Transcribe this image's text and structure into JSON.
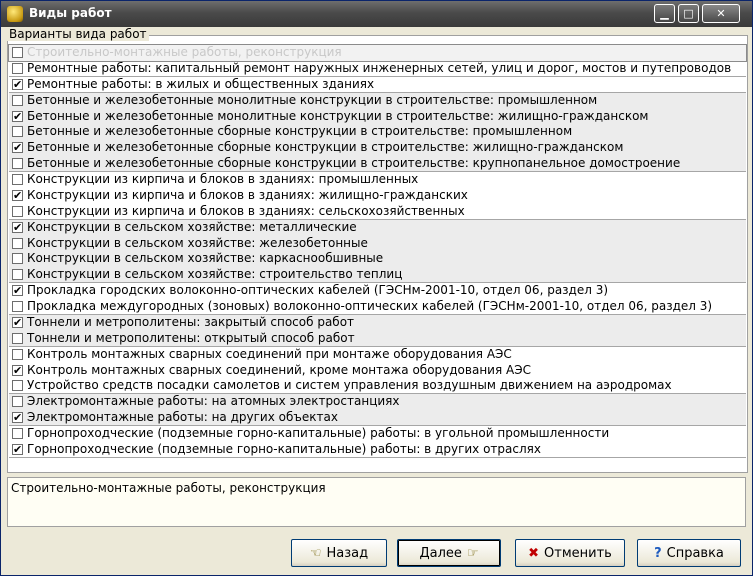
{
  "window": {
    "title": "Виды работ"
  },
  "titlebar": {
    "minimize": "▁",
    "maximize": "□",
    "close": "✕"
  },
  "group": {
    "label": "Варианты вида работ"
  },
  "items": [
    {
      "label": "Строительно-монтажные работы, реконструкция",
      "checked": false,
      "selected": true
    },
    {
      "label": "Ремонтные работы: капитальный ремонт наружных инженерных сетей, улиц и дорог, мостов и путепроводов",
      "checked": false
    },
    {
      "label": "Ремонтные работы: в жилых и общественных зданиях",
      "checked": true
    },
    {
      "label": "Бетонные и железобетонные монолитные конструкции в строительстве: промышленном",
      "checked": false
    },
    {
      "label": "Бетонные и железобетонные монолитные конструкции в строительстве: жилищно-гражданском",
      "checked": true
    },
    {
      "label": "Бетонные и железобетонные сборные конструкции в строительстве: промышленном",
      "checked": false
    },
    {
      "label": "Бетонные и железобетонные сборные конструкции в строительстве: жилищно-гражданском",
      "checked": true
    },
    {
      "label": "Бетонные и железобетонные сборные конструкции в строительстве: крупнопанельное домостроение",
      "checked": false
    },
    {
      "label": "Конструкции из кирпича и блоков в зданиях: промышленных",
      "checked": false
    },
    {
      "label": "Конструкции из кирпича и блоков в зданиях: жилищно-гражданских",
      "checked": true
    },
    {
      "label": "Конструкции из кирпича и блоков в зданиях: сельскохозяйственных",
      "checked": false
    },
    {
      "label": "Конструкции в сельском хозяйстве: металлические",
      "checked": true
    },
    {
      "label": "Конструкции в сельском хозяйстве: железобетонные",
      "checked": false
    },
    {
      "label": "Конструкции в сельском хозяйстве: каркаснообшивные",
      "checked": false
    },
    {
      "label": "Конструкции в сельском хозяйстве: строительство теплиц",
      "checked": false
    },
    {
      "label": "Прокладка городских волоконно-оптических кабелей (ГЭСНм-2001-10, отдел 06, раздел 3)",
      "checked": true
    },
    {
      "label": "Прокладка междугородных (зоновых) волоконно-оптических кабелей (ГЭСНм-2001-10, отдел 06, раздел 3)",
      "checked": false
    },
    {
      "label": "Тоннели и метрополитены: закрытый способ работ",
      "checked": true
    },
    {
      "label": "Тоннели и метрополитены: открытый способ работ",
      "checked": false
    },
    {
      "label": "Контроль монтажных сварных соединений при монтаже оборудования АЭС",
      "checked": false
    },
    {
      "label": "Контроль монтажных сварных соединений, кроме монтажа оборудования АЭС",
      "checked": true
    },
    {
      "label": "Устройство средств посадки самолетов и систем управления воздушным движением на аэродромах",
      "checked": false
    },
    {
      "label": "Электромонтажные работы: на атомных электростанциях",
      "checked": false
    },
    {
      "label": "Электромонтажные работы: на других объектах",
      "checked": true
    },
    {
      "label": "Горнопроходческие (подземные горно-капитальные) работы: в угольной промышленности",
      "checked": false
    },
    {
      "label": "Горнопроходческие (подземные горно-капитальные) работы: в других отраслях",
      "checked": true
    }
  ],
  "description": {
    "text": "Строительно-монтажные работы, реконструкция"
  },
  "buttons": {
    "back": "Назад",
    "next": "Далее",
    "cancel": "Отменить",
    "help": "Справка"
  }
}
